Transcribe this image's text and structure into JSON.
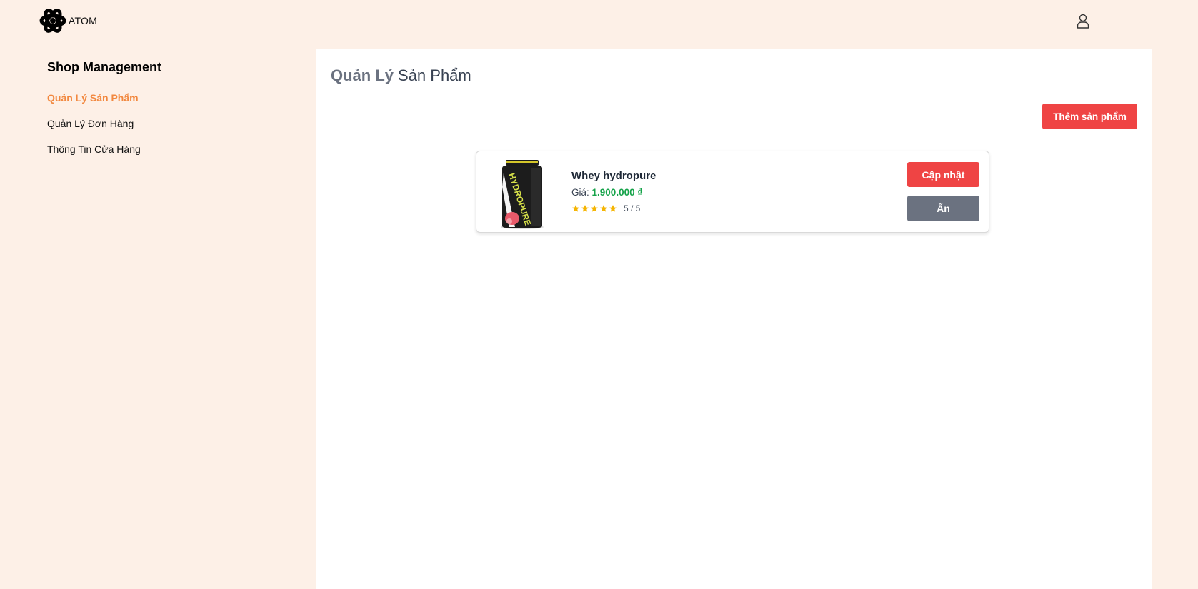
{
  "header": {
    "logo_text": "ATOM",
    "logo_icon": "atom-icon",
    "user_icon": "user-icon"
  },
  "sidebar": {
    "title": "Shop Management",
    "items": [
      {
        "label": "Quản Lý Sản Phẩm",
        "active": true
      },
      {
        "label": "Quản Lý Đơn Hàng",
        "active": false
      },
      {
        "label": "Thông Tin Cửa Hàng",
        "active": false
      }
    ]
  },
  "main": {
    "title_part1": "Quản Lý",
    "title_part2": "Sản Phẩm",
    "add_button_label": "Thêm sản phẩm",
    "products": [
      {
        "name": "Whey hydropure",
        "price_label": "Giá:",
        "price": "1.900.000 ₫",
        "rating_stars": 5,
        "rating_text": "5 / 5",
        "image_text": "HYDROPURE",
        "update_label": "Cập nhật",
        "hide_label": "Ẩn"
      }
    ]
  },
  "colors": {
    "background": "#fdf0e7",
    "accent_orange": "#f2883f",
    "danger_red": "#ef4444",
    "gray_button": "#6b7280",
    "price_green": "#16a34a",
    "star_gold": "#f5b400"
  }
}
